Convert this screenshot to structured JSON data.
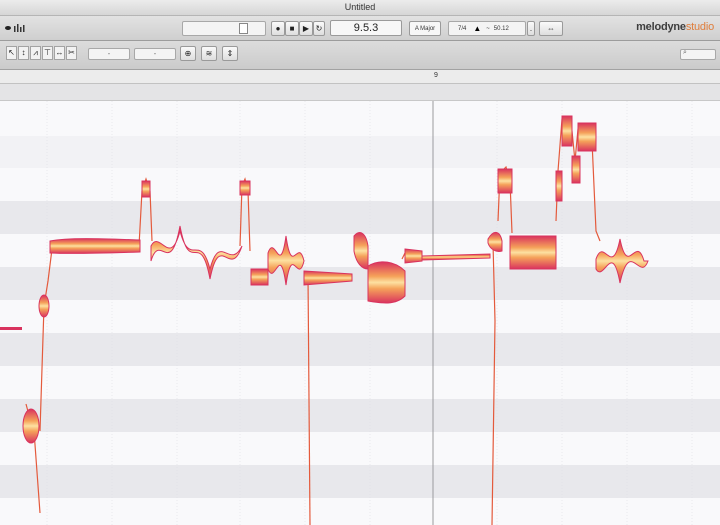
{
  "window": {
    "title": "Untitled"
  },
  "transport": {
    "position": "9.5.3",
    "key": "A Major",
    "time_signature": "7/4",
    "tempo": "50.12",
    "tempo_prefix": "~"
  },
  "brand": {
    "name": "melodyne",
    "edition": "studio"
  },
  "toolbar": {
    "tools": [
      {
        "name": "main-tool-icon",
        "glyph": "↖"
      },
      {
        "name": "pitch-tool-icon",
        "glyph": "↕"
      },
      {
        "name": "formant-tool-icon",
        "glyph": "⩘"
      },
      {
        "name": "amplitude-tool-icon",
        "glyph": "⊤"
      },
      {
        "name": "timing-tool-icon",
        "glyph": "↔"
      },
      {
        "name": "separation-tool-icon",
        "glyph": "✂"
      }
    ],
    "dropdown1": "-",
    "dropdown2": "-"
  },
  "ruler": {
    "bar_label": "9"
  },
  "colors": {
    "blob_outer": "#d9335e",
    "blob_inner": "#fbd38a",
    "pitch_curve": "#e45a3c",
    "row_dark": "#e6e6ea",
    "row_light": "#f9f9fb"
  }
}
